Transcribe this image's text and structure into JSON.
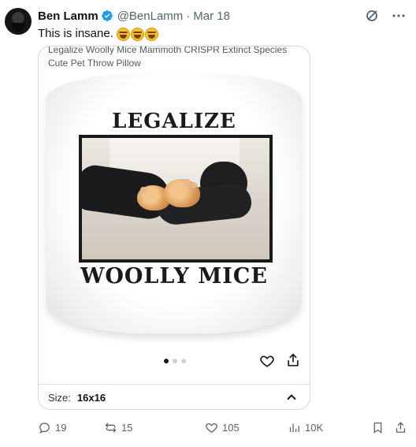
{
  "tweet": {
    "author_name": "Ben Lamm",
    "handle": "@BenLamm",
    "separator": "·",
    "date": "Mar 18",
    "text": "This is insane.",
    "emoji_count": 3,
    "verified_color": "#1d9bf0"
  },
  "card": {
    "product_title": "Legalize Woolly Mice Mammoth CRISPR Extinct Species Cute Pet Throw Pillow",
    "pillow_top_text": "LEGALIZE",
    "pillow_bottom_text": "WOOLLY MICE",
    "carousel": {
      "total": 3,
      "active": 1
    },
    "size_label": "Size:",
    "size_value": "16x16"
  },
  "actions": {
    "replies": "19",
    "reposts": "15",
    "likes": "105",
    "views": "10K"
  },
  "icons": {
    "top": [
      "grok-icon",
      "more-icon"
    ],
    "card": [
      "heart-icon",
      "share-icon",
      "chevron-up-icon"
    ],
    "bar": [
      "reply-icon",
      "repost-icon",
      "like-icon",
      "views-icon",
      "bookmark-icon",
      "share-icon"
    ]
  }
}
